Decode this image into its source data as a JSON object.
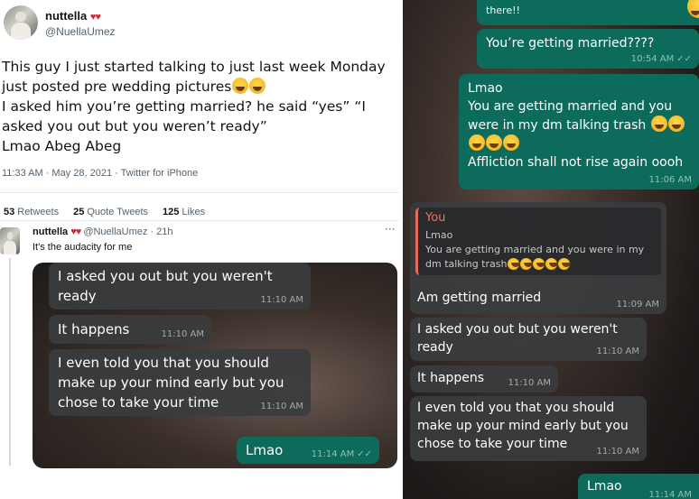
{
  "tweet": {
    "author_name": "nuttella",
    "author_handle": "@NuellaUmez",
    "text": "This guy I just started talking to just last week Monday just posted pre wedding pictures",
    "text2": "I asked him you’re getting married? he said “yes” “I asked you out but you weren’t ready”",
    "text3": "Lmao Abeg Abeg",
    "meta": "11:33 AM · May 28, 2021 · Twitter for iPhone",
    "retweets": "53",
    "retweets_label": "Retweets",
    "quotes": "25",
    "quotes_label": "Quote Tweets",
    "likes": "125",
    "likes_label": "Likes"
  },
  "reply": {
    "author_name": "nuttella",
    "author_handle": "@NuellaUmez · 21h",
    "more": "···",
    "text": "It's the audacity for me"
  },
  "chat_left": [
    {
      "text": "I asked you out but you weren't\nready",
      "time": "11:10 AM"
    },
    {
      "text": "It happens",
      "time": "11:10 AM"
    },
    {
      "text": "I even told you that you should\nmake up your mind early but you\nchose to take your time",
      "time": "11:10 AM"
    },
    {
      "text": "Lmao",
      "time": "11:14 AM"
    }
  ],
  "chat_right": {
    "top_partial": "there!!",
    "msg1": {
      "text": "You’re getting married????",
      "time": "10:54 AM"
    },
    "msg2": {
      "text": "Lmao\nYou are getting married and you\nwere in my dm talking trash",
      "text2": "Affliction shall not rise again oooh",
      "time": "11:06 AM"
    },
    "quote": {
      "author": "You",
      "text": "Lmao\nYou are getting married and you were in my\ndm talking trash"
    },
    "msg3": {
      "text": "Am getting married",
      "time": "11:09 AM"
    },
    "msg4": {
      "text": "I asked you out but you weren't\nready",
      "time": "11:10 AM"
    },
    "msg5": {
      "text": "It happens",
      "time": "11:10 AM"
    },
    "msg6": {
      "text": "I even told you that you should\nmake up your mind early but you\nchose to take your time",
      "time": "11:10 AM"
    },
    "msg7": {
      "text": "Lmao",
      "time": "11:14 AM"
    }
  },
  "colors": {
    "outgoing": "#0d6b5c",
    "incoming": "#3a3c3e",
    "quote_accent": "#e86b5c"
  }
}
